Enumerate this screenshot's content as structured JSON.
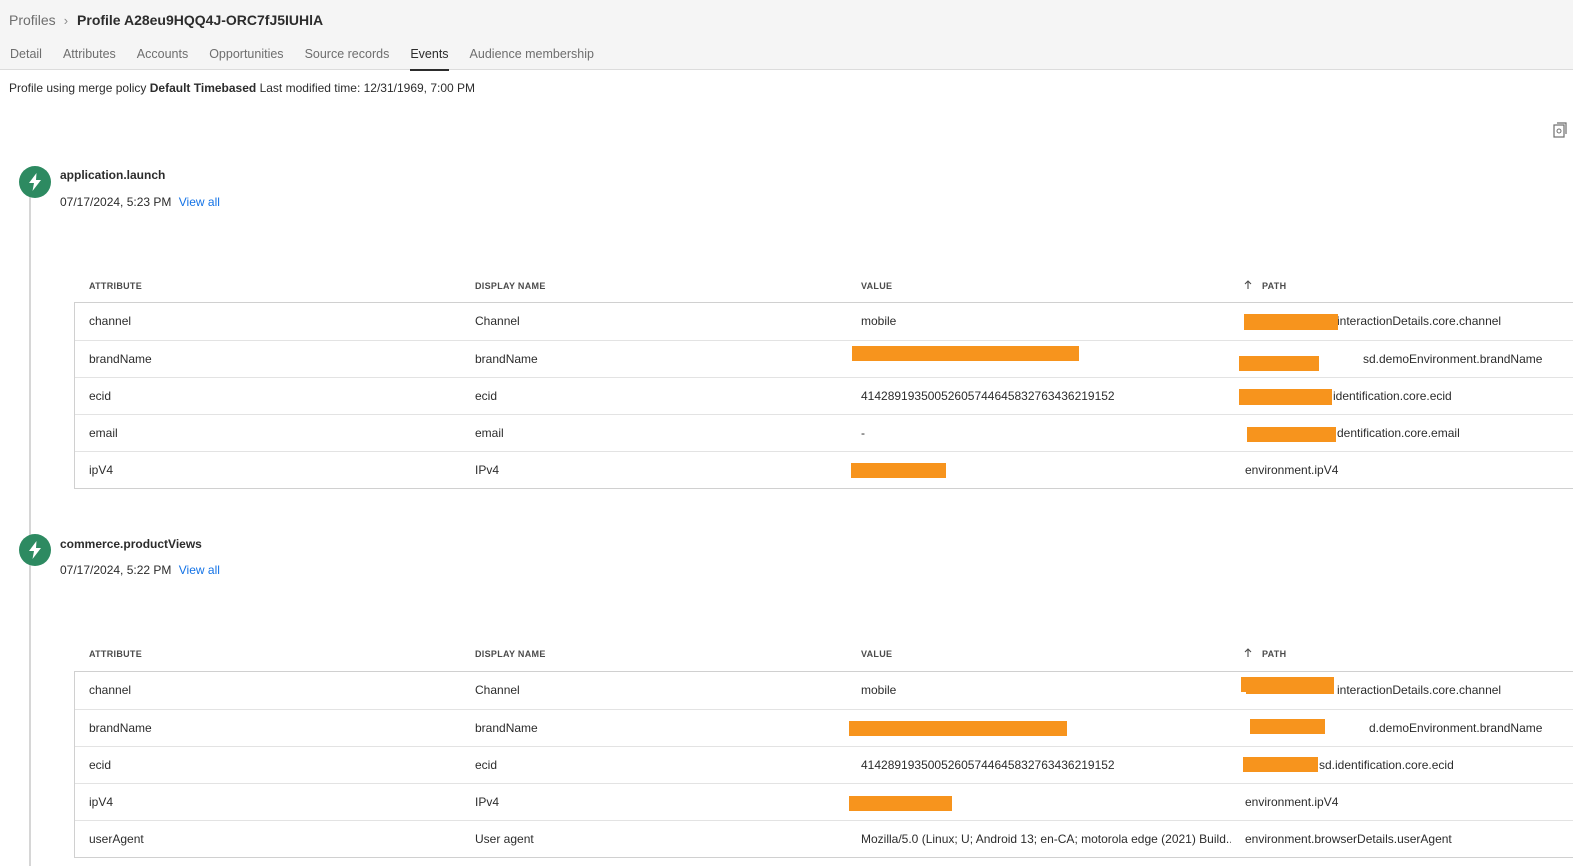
{
  "breadcrumb": {
    "root": "Profiles",
    "current": "Profile A28eu9HQQ4J-ORC7fJ5IUHlA"
  },
  "tabs": [
    "Detail",
    "Attributes",
    "Accounts",
    "Opportunities",
    "Source records",
    "Events",
    "Audience membership"
  ],
  "active_tab": "Events",
  "meta": {
    "prefix": "Profile using merge policy",
    "policy": "Default Timebased",
    "modified": "Last modified time: 12/31/1969, 7:00 PM"
  },
  "table_headers": {
    "attribute": "ATTRIBUTE",
    "display_name": "DISPLAY NAME",
    "value": "VALUE",
    "path": "PATH"
  },
  "events": [
    {
      "title": "application.launch",
      "time": "07/17/2024, 5:23 PM",
      "view_all": "View all",
      "rows": [
        {
          "attribute": "channel",
          "display_name": "Channel",
          "value": "mobile",
          "path": "interactionDetails.core.channel"
        },
        {
          "attribute": "brandName",
          "display_name": "brandName",
          "value": "",
          "path": "sd.demoEnvironment.brandName"
        },
        {
          "attribute": "ecid",
          "display_name": "ecid",
          "value": "41428919350052605744645832763436219152",
          "path": "identification.core.ecid"
        },
        {
          "attribute": "email",
          "display_name": "email",
          "value": "-",
          "path": "dentification.core.email"
        },
        {
          "attribute": "ipV4",
          "display_name": "IPv4",
          "value": "",
          "path": "environment.ipV4"
        }
      ]
    },
    {
      "title": "commerce.productViews",
      "time": "07/17/2024, 5:22 PM",
      "view_all": "View all",
      "rows": [
        {
          "attribute": "channel",
          "display_name": "Channel",
          "value": "mobile",
          "path": "interactionDetails.core.channel"
        },
        {
          "attribute": "brandName",
          "display_name": "brandName",
          "value": "",
          "path": "d.demoEnvironment.brandName"
        },
        {
          "attribute": "ecid",
          "display_name": "ecid",
          "value": "41428919350052605744645832763436219152",
          "path": "sd.identification.core.ecid"
        },
        {
          "attribute": "ipV4",
          "display_name": "IPv4",
          "value": "",
          "path": "environment.ipV4"
        },
        {
          "attribute": "userAgent",
          "display_name": "User agent",
          "value": "Mozilla/5.0 (Linux; U; Android 13; en-CA; motorola edge (2021) Build...",
          "path": "environment.browserDetails.userAgent"
        }
      ]
    }
  ],
  "colors": {
    "event_icon": "#2d8a61",
    "link": "#1473e6",
    "redaction": "#f7941d"
  },
  "icons": [
    "chevron-right-icon",
    "export-icon",
    "lightning-bolt-icon",
    "sort-arrow-up-icon"
  ]
}
